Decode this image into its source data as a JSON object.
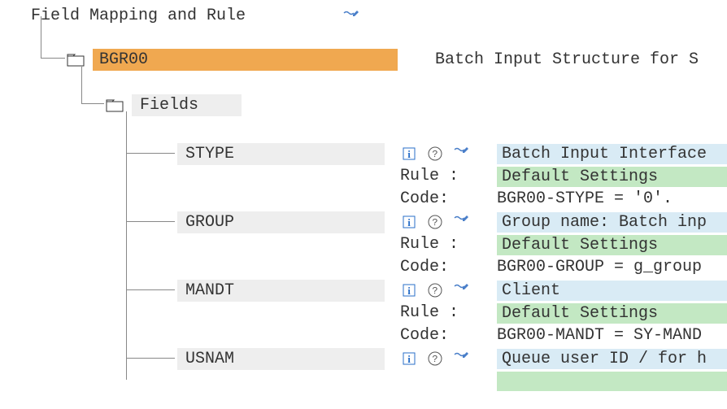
{
  "root": {
    "title": "Field Mapping and Rule"
  },
  "structure": {
    "name": "BGR00",
    "description": "Batch Input Structure for S"
  },
  "fields_label": "Fields",
  "labels": {
    "rule": "Rule :",
    "code": "Code:"
  },
  "fields": [
    {
      "name": "STYPE",
      "description": "Batch Input Interface",
      "rule": "Default Settings",
      "code": "BGR00-STYPE = '0'."
    },
    {
      "name": "GROUP",
      "description": "Group name: Batch inp",
      "rule": "Default Settings",
      "code": "BGR00-GROUP = g_group"
    },
    {
      "name": "MANDT",
      "description": "Client",
      "rule": "Default Settings",
      "code": "BGR00-MANDT = SY-MAND"
    },
    {
      "name": "USNAM",
      "description": "Queue user ID / for h",
      "rule": "",
      "code": ""
    }
  ]
}
